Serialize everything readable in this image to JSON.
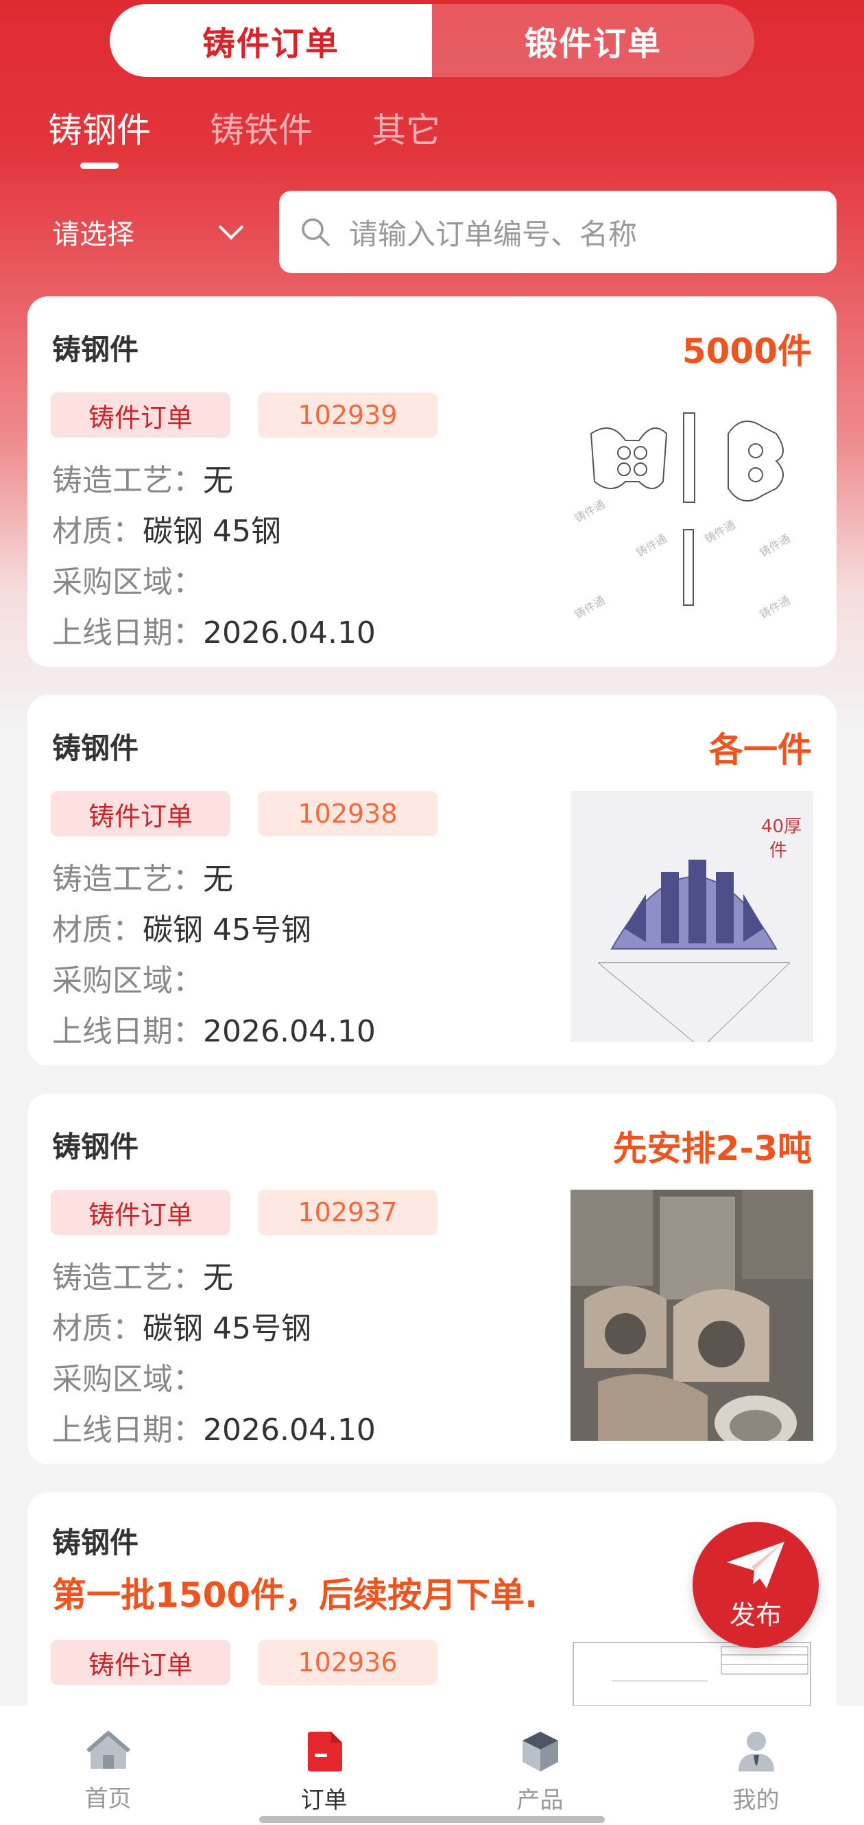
{
  "top_tabs": {
    "active": "铸件订单",
    "inactive": "锻件订单"
  },
  "category_tabs": [
    "铸钢件",
    "铸铁件",
    "其它"
  ],
  "filter": {
    "select_label": "请选择",
    "search_placeholder": "请输入订单编号、名称"
  },
  "labels": {
    "process": "铸造工艺：",
    "material": "材质：",
    "region": "采购区域：",
    "date": "上线日期："
  },
  "orders": [
    {
      "title": "铸钢件",
      "quantity": "5000件",
      "type_tag": "铸件订单",
      "code": "102939",
      "process": "无",
      "material": "碳钢  45钢",
      "region": "",
      "date": "2026.04.10",
      "thumb": "cad-bracket-drawing"
    },
    {
      "title": "铸钢件",
      "quantity": "各一件",
      "type_tag": "铸件订单",
      "code": "102938",
      "process": "无",
      "material": "碳钢  45号钢",
      "region": "",
      "date": "2026.04.10",
      "thumb": "arch-part-drawing"
    },
    {
      "title": "铸钢件",
      "quantity": "先安排2-3吨",
      "type_tag": "铸件订单",
      "code": "102937",
      "process": "无",
      "material": "碳钢  45号钢",
      "region": "",
      "date": "2026.04.10",
      "thumb": "cast-parts-photo"
    },
    {
      "title": "铸钢件",
      "quantity": "第一批1500件，后续按月下单.",
      "type_tag": "铸件订单",
      "code": "102936",
      "thumb": "technical-drawing"
    }
  ],
  "fab": {
    "label": "发布",
    "icon": "paper-plane-icon"
  },
  "bottom_nav": [
    {
      "label": "首页",
      "icon": "home-icon",
      "active": false
    },
    {
      "label": "订单",
      "icon": "order-document-icon",
      "active": true
    },
    {
      "label": "产品",
      "icon": "product-box-icon",
      "active": false
    },
    {
      "label": "我的",
      "icon": "user-icon",
      "active": false
    }
  ],
  "colors": {
    "brand_red": "#d9252c",
    "quantity_orange": "#f0541e",
    "tag_pink_bg": "#fde0e0"
  }
}
